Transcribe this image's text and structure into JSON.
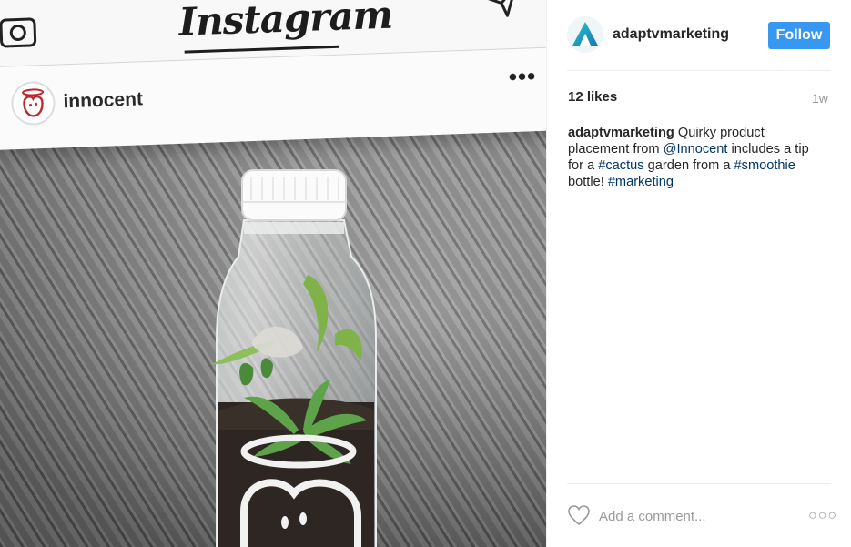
{
  "photo": {
    "app_title": "Instagram",
    "account": "innocent",
    "more_glyph": "•••",
    "icons": [
      "camera-icon",
      "send-icon",
      "innocent-logo-icon",
      "bottle-image"
    ]
  },
  "panel": {
    "username": "adaptvmarketing",
    "follow_label": "Follow",
    "likes": "12 likes",
    "time": "1w",
    "caption": {
      "user": "adaptvmarketing",
      "t1": " Quirky product placement from ",
      "mention": "@Innocent",
      "t2": " includes a tip for a ",
      "tag1": "#cactus",
      "t3": " garden from a ",
      "tag2": "#smoothie",
      "t4": " bottle! ",
      "tag3": "#marketing"
    },
    "comment_placeholder": "Add a comment...",
    "more_glyph": "○○○"
  },
  "colors": {
    "follow_bg": "#3897f0",
    "link": "#003569",
    "muted": "#999999",
    "brand_teal": "#2ab3c2"
  }
}
